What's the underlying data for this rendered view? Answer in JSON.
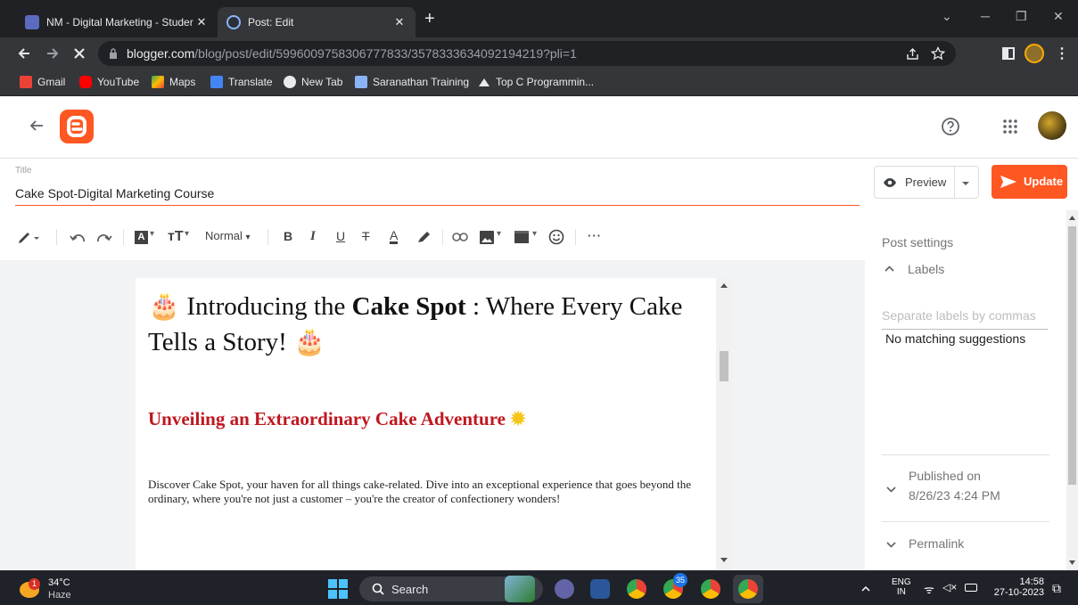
{
  "browser": {
    "tabs": [
      {
        "title": "NM - Digital Marketing - Studer",
        "close": "✕",
        "active": false
      },
      {
        "title": "Post: Edit",
        "close": "✕",
        "active": true
      }
    ],
    "new_tab": "+",
    "window_controls": {
      "minimize": "─",
      "restore": "❐",
      "close": "✕",
      "dropdown": "⌄"
    },
    "url_host": "blogger.com",
    "url_path": "/blog/post/edit/5996009758306777833/3578333634092194219?pli=1",
    "bookmarks": [
      {
        "label": "Gmail",
        "icon": "gmail-icon",
        "color": "#ea4335"
      },
      {
        "label": "YouTube",
        "icon": "youtube-icon",
        "color": "#ff0000"
      },
      {
        "label": "Maps",
        "icon": "maps-icon",
        "color": "#34a853"
      },
      {
        "label": "Translate",
        "icon": "translate-icon",
        "color": "#4285f4"
      },
      {
        "label": "New Tab",
        "icon": "globe-icon",
        "color": "#e8eaed"
      },
      {
        "label": "Saranathan Training",
        "icon": "site-icon",
        "color": "#8ab4f8"
      },
      {
        "label": "Top C Programmin...",
        "icon": "triangle-icon",
        "color": "#e8eaed"
      }
    ]
  },
  "blogger": {
    "title_label": "Title",
    "title_value": "Cake Spot-Digital Marketing Course",
    "preview_label": "Preview",
    "update_label": "Update",
    "brand_color": "#ff5722",
    "toolbar": {
      "format_label": "Normal"
    },
    "post": {
      "headline_pre": "Introducing the ",
      "headline_bold": "Cake Spot",
      "headline_post": " : Where Every Cake Tells a Story!",
      "subheading": "Unveiling an Extraordinary Cake Adventure",
      "body": "Discover Cake Spot, your haven for all things cake-related. Dive into an exceptional experience that goes beyond the ordinary, where you're not just a customer – you're the creator of confectionery wonders!"
    },
    "settings": {
      "heading": "Post settings",
      "labels_title": "Labels",
      "labels_placeholder": "Separate labels by commas",
      "no_suggestions": "No matching suggestions",
      "published_label": "Published on",
      "published_date": "8/26/23 4:24 PM",
      "permalink_label": "Permalink"
    }
  },
  "taskbar": {
    "weather_temp": "34°C",
    "weather_desc": "Haze",
    "weather_badge": "1",
    "search_label": "Search",
    "chrome_badge": "35",
    "lang_top": "ENG",
    "lang_bottom": "IN",
    "time": "14:58",
    "date": "27-10-2023"
  }
}
